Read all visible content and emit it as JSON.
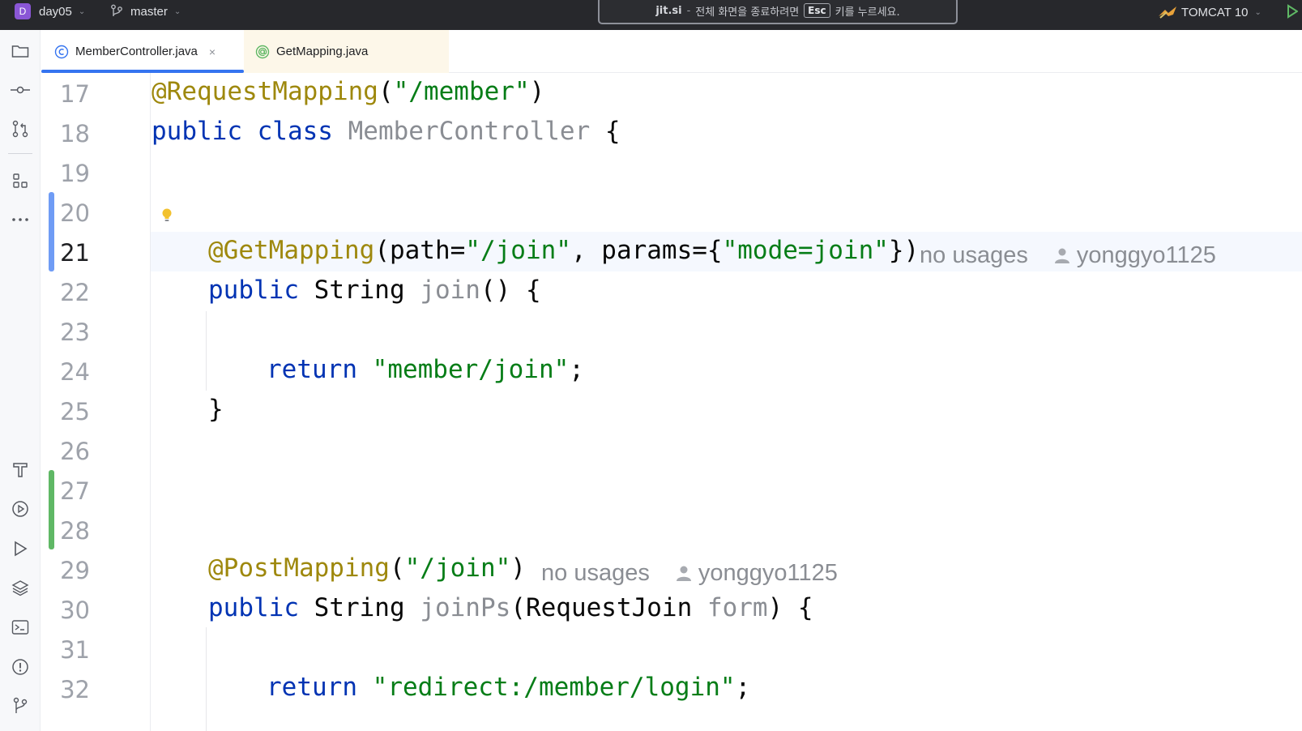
{
  "title_bar": {
    "project_initial": "D",
    "project_name": "day05",
    "branch": "master",
    "banner": {
      "site": "jit.si",
      "separator": "-",
      "message_before": "전체 화면을 종료하려면",
      "key": "Esc",
      "message_after": "키를 누르세요."
    },
    "run_config": "TOMCAT 10"
  },
  "tabs": [
    {
      "label": "MemberController.java",
      "icon": "class-icon",
      "active": true,
      "close": "×"
    },
    {
      "label": "GetMapping.java",
      "icon": "annotation-icon",
      "active": false
    }
  ],
  "editor": {
    "lines": [
      {
        "number": "17"
      },
      {
        "number": "18"
      },
      {
        "number": "19"
      },
      {
        "number": "20"
      },
      {
        "number": "21",
        "current": true
      },
      {
        "number": "22"
      },
      {
        "number": "23"
      },
      {
        "number": "24"
      },
      {
        "number": "25"
      },
      {
        "number": "26"
      },
      {
        "number": "27"
      },
      {
        "number": "28"
      },
      {
        "number": "29"
      },
      {
        "number": "30"
      },
      {
        "number": "31"
      },
      {
        "number": "32"
      }
    ],
    "code": {
      "l17_ann": "@RequestMapping",
      "l17_open": "(",
      "l17_str": "\"/member\"",
      "l17_close": ")",
      "l18_kw": "public class ",
      "l18_name": "MemberController",
      "l18_brace": " {",
      "l21_ann": "@GetMapping",
      "l21_p1": "(path=",
      "l21_s1": "\"/join\"",
      "l21_p2": ", params={",
      "l21_s2": "\"mode=join\"",
      "l21_p3": "})",
      "l22_kw": "public ",
      "l22_type": "String ",
      "l22_name": "join",
      "l22_rest": "() {",
      "l24_kw": "return ",
      "l24_str": "\"member/join\"",
      "l24_semi": ";",
      "l25_brace": "}",
      "l29_ann": "@PostMapping",
      "l29_open": "(",
      "l29_str": "\"/join\"",
      "l29_close": ")",
      "l30_kw": "public ",
      "l30_type": "String ",
      "l30_name": "joinPs",
      "l30_p1": "(RequestJoin ",
      "l30_param": "form",
      "l30_p2": ") {",
      "l32_kw": "return ",
      "l32_str": "\"redirect:/member/login\"",
      "l32_semi": ";"
    },
    "inlay_hints": {
      "l21_usages": "no usages",
      "l21_author": "yonggyo1125",
      "l29_usages": "no usages",
      "l29_author": "yonggyo1125"
    }
  },
  "colors": {
    "annotation": "#9e880d",
    "keyword": "#0033b3",
    "string": "#067d17",
    "accent": "#3574f0"
  }
}
